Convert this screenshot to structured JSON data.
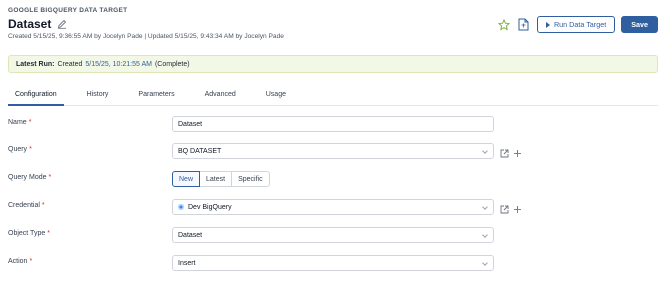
{
  "header": {
    "eyebrow": "GOOGLE BIGQUERY DATA TARGET",
    "title": "Dataset",
    "meta": "Created 5/15/25, 9:36:55 AM by Jocelyn Pade  |  Updated 5/15/25, 9:43:34 AM by Jocelyn Pade"
  },
  "actions": {
    "run_label": "Run Data Target",
    "save_label": "Save"
  },
  "banner": {
    "label": "Latest Run:",
    "prefix": "Created",
    "link": "5/15/25, 10:21:55 AM",
    "suffix": "(Complete)"
  },
  "tabs": [
    "Configuration",
    "History",
    "Parameters",
    "Advanced",
    "Usage"
  ],
  "form": {
    "name": {
      "label": "Name",
      "value": "Dataset"
    },
    "query": {
      "label": "Query",
      "value": "BQ DATASET"
    },
    "query_mode": {
      "label": "Query Mode",
      "options": [
        "New",
        "Latest",
        "Specific"
      ],
      "selected": "New"
    },
    "credential": {
      "label": "Credential",
      "value": "Dev BigQuery"
    },
    "object_type": {
      "label": "Object Type",
      "value": "Dataset"
    },
    "action": {
      "label": "Action",
      "value": "Insert"
    },
    "required_marker": "*"
  },
  "colors": {
    "accent": "#2f5f9e",
    "banner_bg": "#f3f8e6",
    "required": "#dc2626",
    "star": "#7cb342"
  }
}
